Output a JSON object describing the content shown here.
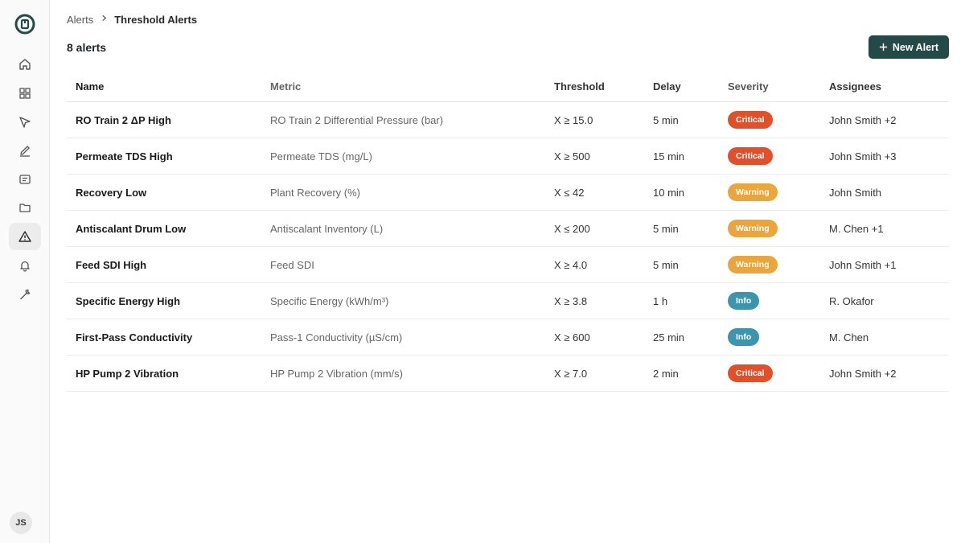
{
  "sidebar": {
    "nav": [
      {
        "icon": "home-icon"
      },
      {
        "icon": "dashboard-icon"
      },
      {
        "icon": "navigation-icon"
      },
      {
        "icon": "edit-icon"
      },
      {
        "icon": "message-icon"
      },
      {
        "icon": "folder-icon"
      },
      {
        "icon": "alert-triangle-icon",
        "active": true
      },
      {
        "icon": "bell-icon"
      },
      {
        "icon": "wrench-icon"
      }
    ],
    "avatar_initials": "JS"
  },
  "breadcrumb": {
    "parent": "Alerts",
    "current": "Threshold Alerts"
  },
  "alerts_count": "8 alerts",
  "new_alert_label": "New Alert",
  "table": {
    "headers": {
      "name": "Name",
      "metric": "Metric",
      "threshold": "Threshold",
      "delay": "Delay",
      "severity": "Severity",
      "assignees": "Assignees"
    },
    "rows": [
      {
        "name": "RO Train 2 ΔP High",
        "metric": "RO Train 2 Differential Pressure (bar)",
        "threshold": "X ≥ 15.0",
        "delay": "5 min",
        "severity": "Critical",
        "assignees": "John Smith +2"
      },
      {
        "name": "Permeate TDS High",
        "metric": "Permeate TDS (mg/L)",
        "threshold": "X ≥ 500",
        "delay": "15 min",
        "severity": "Critical",
        "assignees": "John Smith +3"
      },
      {
        "name": "Recovery Low",
        "metric": "Plant Recovery (%)",
        "threshold": "X ≤ 42",
        "delay": "10 min",
        "severity": "Warning",
        "assignees": "John Smith"
      },
      {
        "name": "Antiscalant Drum Low",
        "metric": "Antiscalant Inventory (L)",
        "threshold": "X ≤ 200",
        "delay": "5 min",
        "severity": "Warning",
        "assignees": "M. Chen +1"
      },
      {
        "name": "Feed SDI High",
        "metric": "Feed SDI",
        "threshold": "X ≥ 4.0",
        "delay": "5 min",
        "severity": "Warning",
        "assignees": "John Smith +1"
      },
      {
        "name": "Specific Energy High",
        "metric": "Specific Energy (kWh/m³)",
        "threshold": "X ≥ 3.8",
        "delay": "1 h",
        "severity": "Info",
        "assignees": "R. Okafor"
      },
      {
        "name": "First-Pass Conductivity",
        "metric": "Pass-1 Conductivity (µS/cm)",
        "threshold": "X ≥ 600",
        "delay": "25 min",
        "severity": "Info",
        "assignees": "M. Chen"
      },
      {
        "name": "HP Pump 2 Vibration",
        "metric": "HP Pump 2 Vibration (mm/s)",
        "threshold": "X ≥ 7.0",
        "delay": "2 min",
        "severity": "Critical",
        "assignees": "John Smith +2"
      }
    ]
  },
  "colors": {
    "accent": "#244a48",
    "critical": "#e0512b",
    "warning": "#eaa53c",
    "info": "#3b95ad"
  }
}
